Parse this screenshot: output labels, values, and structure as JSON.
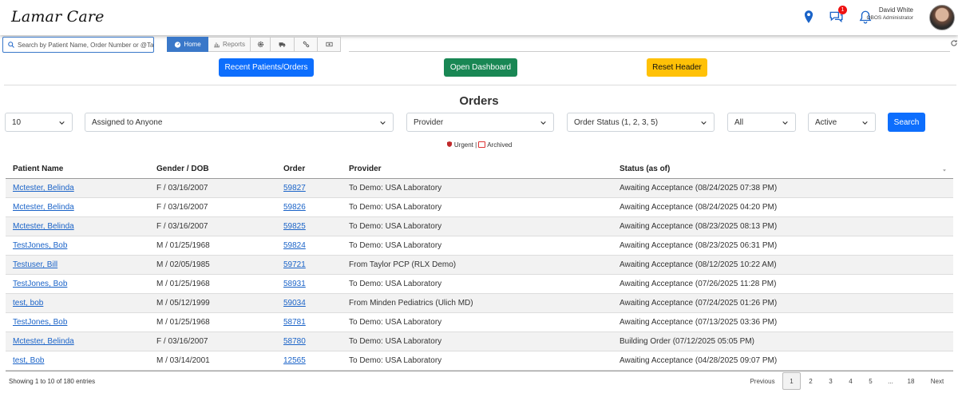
{
  "header": {
    "logo": "Lamar Care",
    "messages_badge": "1",
    "user_name": "David White",
    "user_role": "OBOS Administrator"
  },
  "search": {
    "placeholder": "Search by Patient Name, Order Number or @Tag"
  },
  "tabs": [
    {
      "label": "Home",
      "icon": "home-icon",
      "active": true
    },
    {
      "label": "Reports",
      "icon": "bar-chart-icon",
      "active": false
    },
    {
      "label": "",
      "icon": "gear-icon",
      "active": false
    },
    {
      "label": "",
      "icon": "truck-icon",
      "active": false
    },
    {
      "label": "",
      "icon": "link-icon",
      "active": false
    },
    {
      "label": "",
      "icon": "money-icon",
      "active": false
    }
  ],
  "actions": {
    "recent": "Recent Patients/Orders",
    "dashboard": "Open Dashboard",
    "reset": "Reset Header"
  },
  "title": "Orders",
  "filters": {
    "page_size": "10",
    "assigned": "Assigned to Anyone",
    "provider": "Provider",
    "order_status": "Order Status (1, 2, 3, 5)",
    "all": "All",
    "active": "Active",
    "search_button": "Search"
  },
  "legend": {
    "urgent": "Urgent",
    "sep": "|",
    "archived": "Archived"
  },
  "columns": [
    "Patient Name",
    "Gender / DOB",
    "Order",
    "Provider",
    "Status (as of)"
  ],
  "rows": [
    {
      "name": "Mctester, Belinda",
      "gdob": "F / 03/16/2007",
      "order": "59827",
      "provider": "To Demo: USA Laboratory",
      "status": "Awaiting Acceptance (08/24/2025 07:38 PM)"
    },
    {
      "name": "Mctester, Belinda",
      "gdob": "F / 03/16/2007",
      "order": "59826",
      "provider": "To Demo: USA Laboratory",
      "status": "Awaiting Acceptance (08/24/2025 04:20 PM)"
    },
    {
      "name": "Mctester, Belinda",
      "gdob": "F / 03/16/2007",
      "order": "59825",
      "provider": "To Demo: USA Laboratory",
      "status": "Awaiting Acceptance (08/23/2025 08:13 PM)"
    },
    {
      "name": "TestJones, Bob",
      "gdob": "M / 01/25/1968",
      "order": "59824",
      "provider": "To Demo: USA Laboratory",
      "status": "Awaiting Acceptance (08/23/2025 06:31 PM)"
    },
    {
      "name": "Testuser, Bill",
      "gdob": "M / 02/05/1985",
      "order": "59721",
      "provider": "From Taylor PCP (RLX Demo)",
      "status": "Awaiting Acceptance (08/12/2025 10:22 AM)"
    },
    {
      "name": "TestJones, Bob",
      "gdob": "M / 01/25/1968",
      "order": "58931",
      "provider": "To Demo: USA Laboratory",
      "status": "Awaiting Acceptance (07/26/2025 11:28 PM)"
    },
    {
      "name": "test, bob",
      "gdob": "M / 05/12/1999",
      "order": "59034",
      "provider": "From Minden Pediatrics (Ulich MD)",
      "status": "Awaiting Acceptance (07/24/2025 01:26 PM)"
    },
    {
      "name": "TestJones, Bob",
      "gdob": "M / 01/25/1968",
      "order": "58781",
      "provider": "To Demo: USA Laboratory",
      "status": "Awaiting Acceptance (07/13/2025 03:36 PM)"
    },
    {
      "name": "Mctester, Belinda",
      "gdob": "F / 03/16/2007",
      "order": "58780",
      "provider": "To Demo: USA Laboratory",
      "status": "Building Order (07/12/2025 05:05 PM)"
    },
    {
      "name": "test, Bob",
      "gdob": "M / 03/14/2001",
      "order": "12565",
      "provider": "To Demo: USA Laboratory",
      "status": "Awaiting Acceptance (04/28/2025 09:07 PM)"
    }
  ],
  "footer": {
    "info": "Showing 1 to 10 of 180 entries",
    "pages": [
      "Previous",
      "1",
      "2",
      "3",
      "4",
      "5",
      "...",
      "18",
      "Next"
    ],
    "active_page": "1"
  }
}
